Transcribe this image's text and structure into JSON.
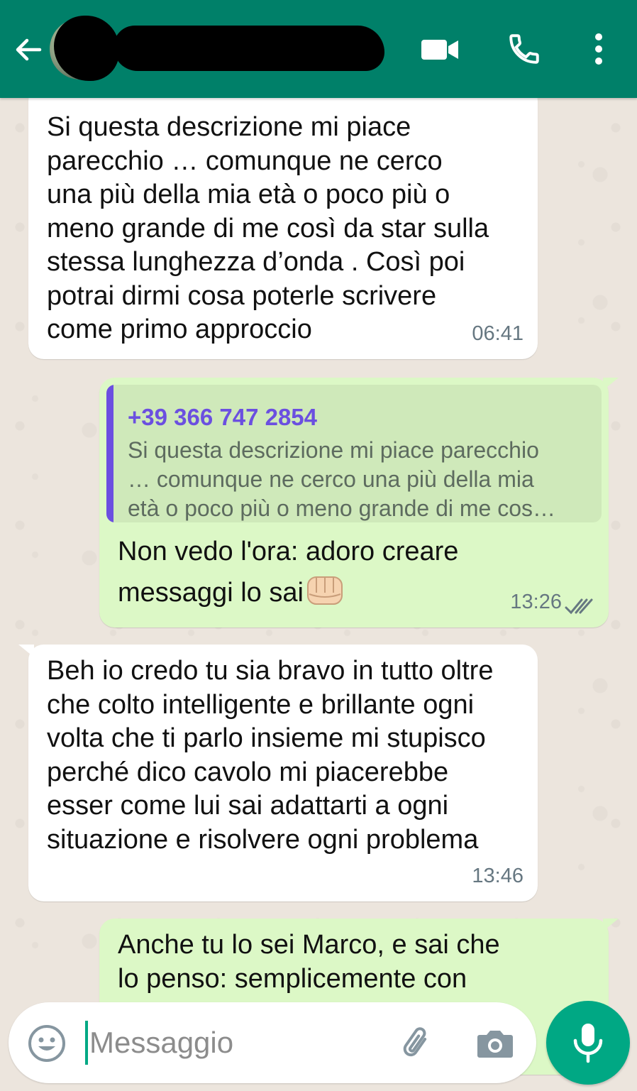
{
  "header": {
    "contact_name": "",
    "colors": {
      "bar": "#008069",
      "icon": "#FFFFFF"
    },
    "icons": [
      "back-arrow-icon",
      "video-call-icon",
      "phone-icon",
      "more-vert-icon"
    ]
  },
  "messages": [
    {
      "direction": "incoming",
      "text": "Si questa descrizione mi piace\nparecchio … comunque ne cerco\nuna più della mia età o poco più o\nmeno grande di me così da star sulla\nstessa lunghezza d’onda . Così poi\npotrai dirmi cosa poterle scrivere\ncome primo approccio",
      "time": "06:41"
    },
    {
      "direction": "outgoing",
      "quote": {
        "sender": "+39 366 747 2854",
        "text": "Si questa descrizione mi piace parecchio\n… comunque ne cerco una più della mia\netà o poco più o meno grande di me cos…"
      },
      "text": "Non vedo l'ora: adoro creare\nmessaggi lo sai",
      "time": "13:26",
      "status": "read-double-tick"
    },
    {
      "direction": "incoming",
      "text": "Beh io credo tu sia bravo in tutto oltre\nche colto intelligente e brillante ogni\nvolta che ti parlo insieme mi stupisco\nperché dico cavolo mi piacerebbe\nesser come lui sai adattarti a ogni\nsituazione e risolvere ogni problema",
      "time": "13:46"
    },
    {
      "direction": "outgoing",
      "text": "Anche tu lo sei Marco, e sai che\nlo penso: semplicemente con"
    }
  ],
  "composer": {
    "placeholder": "Messaggio",
    "icons": [
      "emoji-icon",
      "attach-icon",
      "camera-icon",
      "mic-icon"
    ],
    "accent": "#00A884"
  }
}
